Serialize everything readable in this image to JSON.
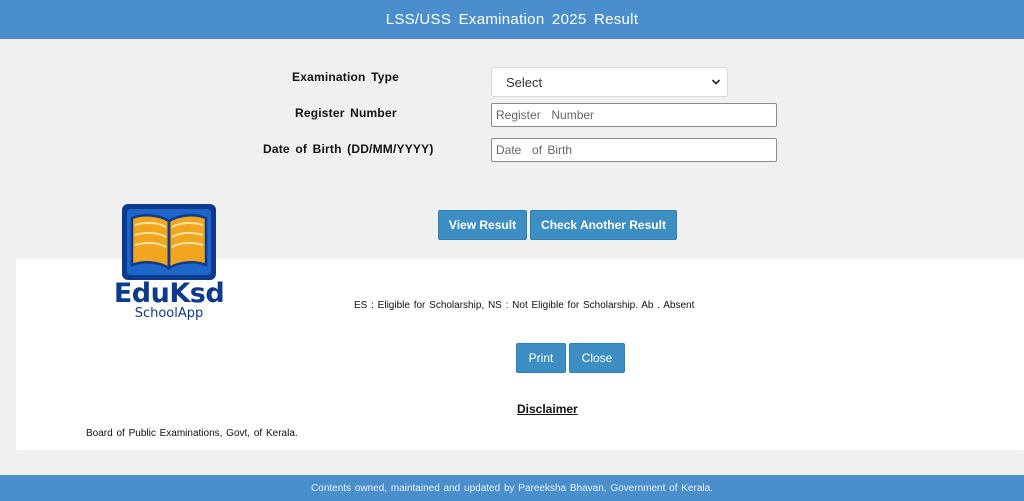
{
  "header": {
    "title": "LSS/USS  Examination  2025 Result"
  },
  "form": {
    "exam_type_label": "Examination  Type",
    "exam_type_selected": "Select",
    "register_label": "Register Number",
    "register_placeholder": "Register  Number",
    "dob_label": "Date of Birth  (DD/MM/YYYY)",
    "dob_placeholder": "Date  of Birth"
  },
  "actions": {
    "view_result": "View Result",
    "check_another": "Check Another Result"
  },
  "logo": {
    "name": "EduKsd",
    "sub": "SchoolApp"
  },
  "result_panel": {
    "legend": "ES : Eligible  for Scholarship,  NS : Not Eligible  for Scholarship.  Ab . Absent",
    "print": "Print",
    "close": "Close",
    "disclaimer": "Disclaimer",
    "board": "Board of Public Examinations,  Govt,  of Kerala."
  },
  "footer": {
    "text": "Contents owned, maintained and updated by Pareeksha  Bhavan,  Government  of Kerala."
  },
  "colors": {
    "header": "#4a8fcb",
    "button": "#3d8ec3",
    "logo_blue": "#0d3a8c",
    "book_orange": "#f2a51f"
  }
}
